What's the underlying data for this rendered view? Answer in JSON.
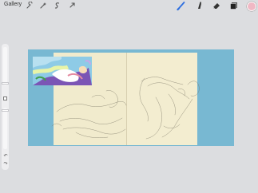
{
  "topbar": {
    "gallery_label": "Gallery",
    "left_tools": [
      "wrench-icon",
      "magic-wand-icon",
      "selection-icon",
      "transform-arrow-icon"
    ],
    "right_tools": [
      "brush-icon",
      "smudge-icon",
      "eraser-icon",
      "layers-icon"
    ],
    "active_tool": "brush-icon",
    "accent_color": "#2f6fe0",
    "current_color": "#f0b8c4"
  },
  "sidebar": {
    "undo_glyph": "↶",
    "redo_glyph": "↷"
  },
  "canvas": {
    "background_color": "#78b8d2",
    "paper_color": "#f1ebcd"
  }
}
